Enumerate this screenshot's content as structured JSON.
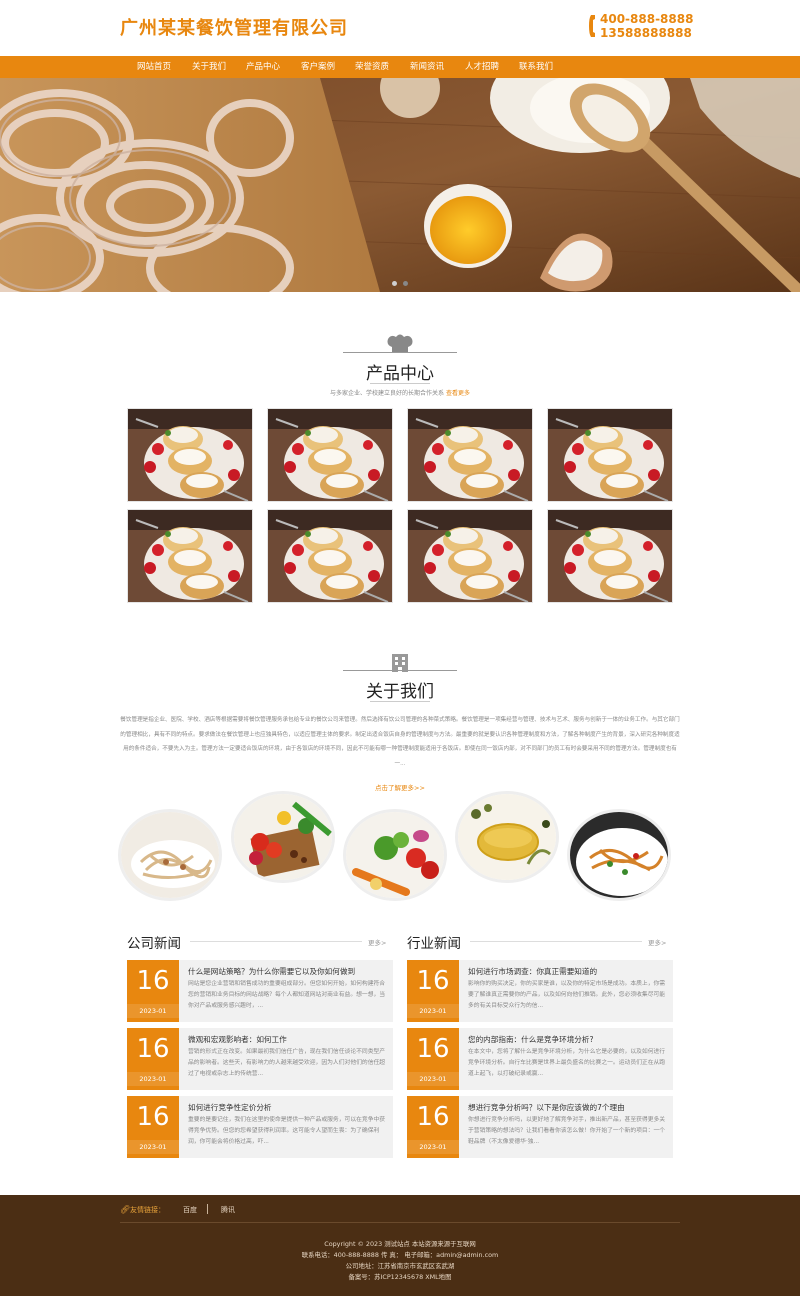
{
  "header": {
    "logo_text": "广州某某餐饮管理有限公司",
    "phone1": "400-888-8888",
    "phone2": "13588888888",
    "brand_color": "#e8870f"
  },
  "nav": {
    "items": [
      "网站首页",
      "关于我们",
      "产品中心",
      "客户案例",
      "荣誉资质",
      "新闻资讯",
      "人才招聘",
      "联系我们"
    ]
  },
  "products": {
    "title": "产品中心",
    "subtitle": "与多家企业、学校建立良好的长期合作关系",
    "more": "查看更多"
  },
  "about": {
    "title": "关于我们",
    "text": "餐饮管理是指企业、医院、学校、酒店等根据需要将餐饮管理服务承包给专业的餐饮公司来管理。然后选择有饮公司管理的各种菜式策略。餐饮管理是一项集经营与管理、技术与艺术、服务与创新于一体的业务工作。与其它部门的管理相比，具有不同的特点。要求做法在餐饮管理上也应独具特色，以适应管理主体的要求。制定出适合饭店自身的管理制度与方法。最重要的就是要认识各种管理制度和方法，了解各种制度产生的背景，深入研究各种制度适用的条件适合，不要先入为主。管理方法一定要适合饭店的环境，由于各饭店的环境不同，因此不可能有哪一种管理制度能适用于各饭店。即使在同一饭店内部，对不同部门的员工有时会要采用不同的管理方法。管理制度也有一...",
    "more": "点击了解更多>>"
  },
  "news": {
    "company": {
      "title": "公司新闻",
      "more": "更多>",
      "items": [
        {
          "day": "16",
          "month": "2023-01",
          "title": "什么是网站策略？为什么你需要它以及你如何做到",
          "desc": "网站是您企业营销和销售成功的重要组成部分。但您如何开始，如何构建符合您的营销和业务目标的网站战略？每个人都知道网站对商业有益。想一想，当你对产品或服务感兴趣时，..."
        },
        {
          "day": "16",
          "month": "2023-01",
          "title": "微观和宏观影响者：如何工作",
          "desc": "营销的形式正在改变。如果最初我们信任广告，现在我们信任谈论不同类型产品的影响者。这些天，有影响力的人越来越受欢迎，因为人们对他们的信任超过了电视或杂志上的传统营..."
        },
        {
          "day": "16",
          "month": "2023-01",
          "title": "如何进行竞争性定价分析",
          "desc": "重要的是要记住，我们在这里的使命是提供一种产品或服务，可以在竞争中获得竞争优势。但您的您希望获得利润率。这可能令人望而生畏：为了确保利润，你可能会将价格过高，吓..."
        }
      ]
    },
    "industry": {
      "title": "行业新闻",
      "more": "更多>",
      "items": [
        {
          "day": "16",
          "month": "2023-01",
          "title": "如何进行市场调查：你真正需要知道的",
          "desc": "影响你的购买决定，你的买家是谁，以及你的特定市场是成功。本质上，你需要了解谁真正需要你的产品，以及如何向他们推销。此外，您必须收集尽可能多的有关目标受众行为的信..."
        },
        {
          "day": "16",
          "month": "2023-01",
          "title": "您的内部指南：什么是竞争环境分析?",
          "desc": "在本文中，您将了解什么是竞争环境分析，为什么它是必要的，以及如何进行竞争环境分析。自行车比赛是世界上最负盛名的比赛之一。运动员们正在从跑道上起飞，以打破纪录或赢..."
        },
        {
          "day": "16",
          "month": "2023-01",
          "title": "想进行竞争分析吗？以下是你应该做的7个理由",
          "desc": "你想进行竞争分析吗，以更好地了解竞争对手，推出新产品，甚至获得更多关于营销策略的想法吗？让我们看看你该怎么做！你开始了一个新的项目：一个鞋品牌（不太像爱德华·独..."
        }
      ]
    }
  },
  "footer": {
    "links_label": "友情链接：",
    "links": [
      "百度",
      "腾讯"
    ],
    "copyright": "Copyright © 2023 测试站点 本站资源来源于互联网",
    "contact": "联系电话：400-888-8888 传 真：   电子邮箱：admin@admin.com",
    "address": "公司地址：江苏省南京市玄武区玄武湖",
    "icp": "备案号：苏ICP12345678 XML地图",
    "bg_color": "#4b2e14"
  }
}
